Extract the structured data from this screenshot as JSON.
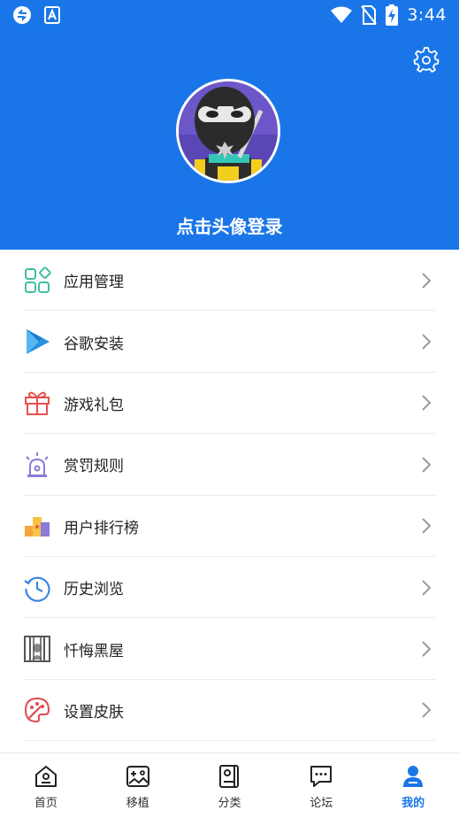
{
  "status_bar": {
    "time": "3:44",
    "left_icons": [
      "sync-icon",
      "font-icon"
    ],
    "right_icons": [
      "wifi-icon",
      "no-sim-icon",
      "battery-charging-icon"
    ]
  },
  "header": {
    "background_color": "#1a76e8",
    "login_prompt": "点击头像登录",
    "settings_icon": "gear-icon"
  },
  "menu": {
    "items": [
      {
        "label": "应用管理",
        "icon": "app-grid-icon",
        "color": "#3fbfa2"
      },
      {
        "label": "谷歌安装",
        "icon": "play-store-icon",
        "color": "#2a8fe0"
      },
      {
        "label": "游戏礼包",
        "icon": "gift-icon",
        "color": "#e8504f"
      },
      {
        "label": "赏罚规则",
        "icon": "alarm-light-icon",
        "color": "#8b7ad6"
      },
      {
        "label": "用户排行榜",
        "icon": "ranking-icon",
        "color": "#f4a63b"
      },
      {
        "label": "历史浏览",
        "icon": "history-icon",
        "color": "#3b86e0"
      },
      {
        "label": "忏悔黑屋",
        "icon": "jail-icon",
        "color": "#555555"
      },
      {
        "label": "设置皮肤",
        "icon": "palette-icon",
        "color": "#e04b4b"
      }
    ]
  },
  "bottom_nav": {
    "active_color": "#1a76e8",
    "items": [
      {
        "label": "首页",
        "icon": "home-icon"
      },
      {
        "label": "移植",
        "icon": "gamepad-icon"
      },
      {
        "label": "分类",
        "icon": "category-book-icon"
      },
      {
        "label": "论坛",
        "icon": "forum-chat-icon"
      },
      {
        "label": "我的",
        "icon": "profile-icon",
        "active": true
      }
    ]
  }
}
